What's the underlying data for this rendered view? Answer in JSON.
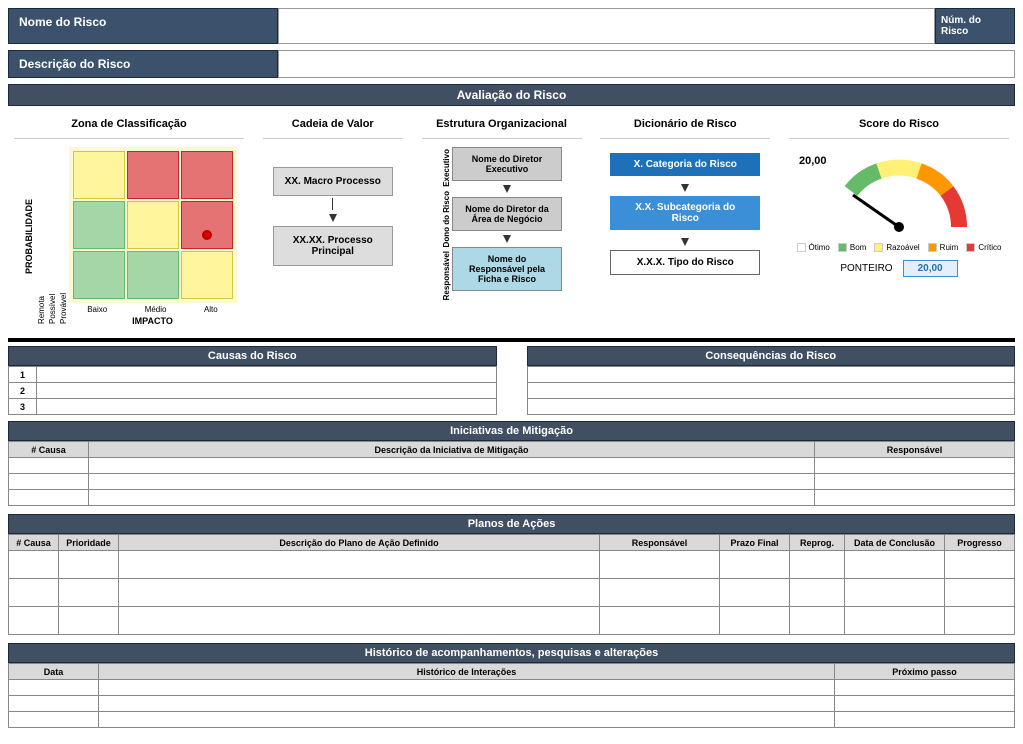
{
  "header": {
    "nome_label": "Nome do Risco",
    "num_label": "Núm. do Risco",
    "desc_label": "Descrição do Risco"
  },
  "eval": {
    "title": "Avaliação do Risco",
    "zona": {
      "title": "Zona de Classificação",
      "ylabel": "PROBABILIDADE",
      "xlabel": "IMPACTO",
      "yticks": [
        "Provável",
        "Possível",
        "Remota"
      ],
      "xticks": [
        "Baixo",
        "Médio",
        "Alto"
      ]
    },
    "cadeia": {
      "title": "Cadeia de Valor",
      "box1": "XX. Macro Processo",
      "box2": "XX.XX. Processo Principal"
    },
    "estrutura": {
      "title": "Estrutura Organizacional",
      "labels": [
        "Executivo",
        "Dono do Risco",
        "Responsável"
      ],
      "box1": "Nome do Diretor Executivo",
      "box2": "Nome do Diretor da Área de Negócio",
      "box3": "Nome do Responsável pela Ficha e Risco"
    },
    "dicionario": {
      "title": "Dicionário de Risco",
      "box1": "X. Categoria do Risco",
      "box2": "X.X. Subcategoria do Risco",
      "box3": "X.X.X. Tipo do Risco"
    },
    "score": {
      "title": "Score do Risco",
      "value": "20,00",
      "legend": [
        "Ótimo",
        "Bom",
        "Razoável",
        "Ruim",
        "Crítico"
      ],
      "colors": [
        "#ffffff",
        "#66bb6a",
        "#fff176",
        "#ff9800",
        "#e53935"
      ],
      "ponteiro_label": "PONTEIRO",
      "ponteiro_value": "20,00"
    }
  },
  "causas": {
    "title": "Causas do Risco",
    "rows": [
      "1",
      "2",
      "3"
    ]
  },
  "conseq": {
    "title": "Consequências do Risco"
  },
  "mitigacao": {
    "title": "Iniciativas de Mitigação",
    "cols": [
      "# Causa",
      "Descrição da Iniciativa de Mitigação",
      "Responsável"
    ]
  },
  "planos": {
    "title": "Planos de Ações",
    "cols": [
      "# Causa",
      "Prioridade",
      "Descrição do Plano de Ação Definido",
      "Responsável",
      "Prazo Final",
      "Reprog.",
      "Data de Conclusão",
      "Progresso"
    ]
  },
  "historico": {
    "title": "Histórico de acompanhamentos, pesquisas e alterações",
    "cols": [
      "Data",
      "Histórico de Interações",
      "Próximo passo"
    ]
  }
}
